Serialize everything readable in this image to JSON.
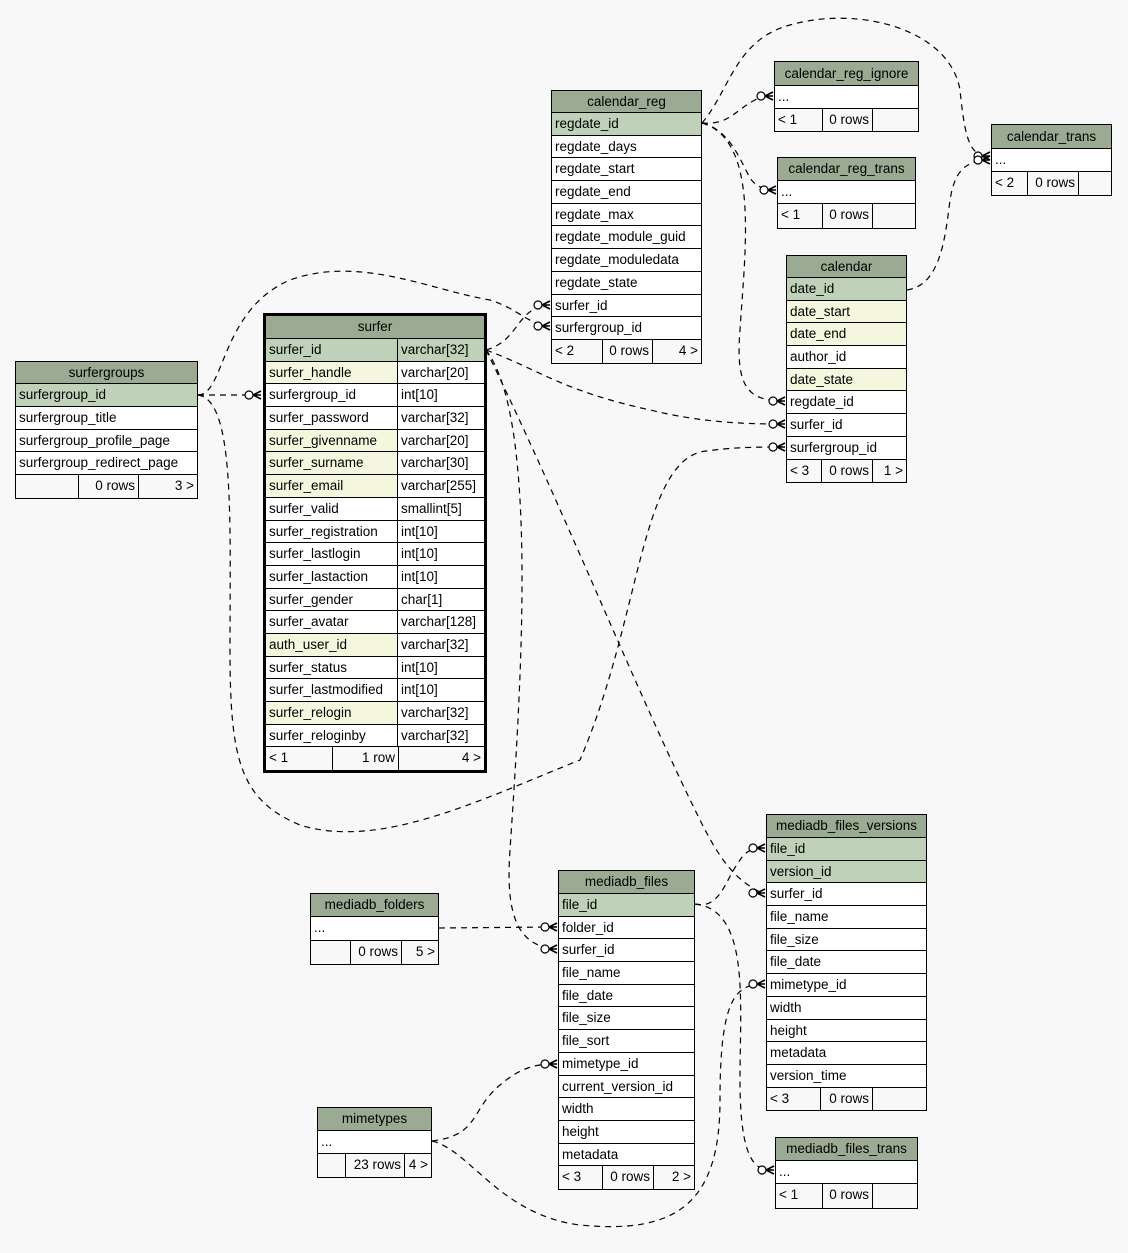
{
  "colors": {
    "background": "#f8f8f8",
    "header": "#9aaa93",
    "primary_key": "#bfd1b9",
    "indexed": "#f4f7de",
    "column": "#ffffff"
  },
  "tables": [
    {
      "name": "surfergroups",
      "columns": [
        {
          "name": "surfergroup_id",
          "kind": "pk"
        },
        {
          "name": "surfergroup_title",
          "kind": ""
        },
        {
          "name": "surfergroup_profile_page",
          "kind": ""
        },
        {
          "name": "surfergroup_redirect_page",
          "kind": ""
        }
      ],
      "footer": [
        "",
        "0 rows",
        "3 >"
      ]
    },
    {
      "name": "surfer",
      "focus": true,
      "columns": [
        {
          "name": "surfer_id",
          "type": "varchar[32]",
          "kind": "pk"
        },
        {
          "name": "surfer_handle",
          "type": "varchar[20]",
          "kind": "idx"
        },
        {
          "name": "surfergroup_id",
          "type": "int[10]",
          "kind": ""
        },
        {
          "name": "surfer_password",
          "type": "varchar[32]",
          "kind": ""
        },
        {
          "name": "surfer_givenname",
          "type": "varchar[20]",
          "kind": "idx"
        },
        {
          "name": "surfer_surname",
          "type": "varchar[30]",
          "kind": "idx"
        },
        {
          "name": "surfer_email",
          "type": "varchar[255]",
          "kind": "idx"
        },
        {
          "name": "surfer_valid",
          "type": "smallint[5]",
          "kind": ""
        },
        {
          "name": "surfer_registration",
          "type": "int[10]",
          "kind": ""
        },
        {
          "name": "surfer_lastlogin",
          "type": "int[10]",
          "kind": ""
        },
        {
          "name": "surfer_lastaction",
          "type": "int[10]",
          "kind": ""
        },
        {
          "name": "surfer_gender",
          "type": "char[1]",
          "kind": ""
        },
        {
          "name": "surfer_avatar",
          "type": "varchar[128]",
          "kind": ""
        },
        {
          "name": "auth_user_id",
          "type": "varchar[32]",
          "kind": "idx"
        },
        {
          "name": "surfer_status",
          "type": "int[10]",
          "kind": ""
        },
        {
          "name": "surfer_lastmodified",
          "type": "int[10]",
          "kind": ""
        },
        {
          "name": "surfer_relogin",
          "type": "varchar[32]",
          "kind": "idx"
        },
        {
          "name": "surfer_reloginby",
          "type": "varchar[32]",
          "kind": ""
        }
      ],
      "footer": [
        "< 1",
        "1 row",
        "4 >"
      ]
    },
    {
      "name": "calendar_reg",
      "columns": [
        {
          "name": "regdate_id",
          "kind": "pk"
        },
        {
          "name": "regdate_days",
          "kind": ""
        },
        {
          "name": "regdate_start",
          "kind": ""
        },
        {
          "name": "regdate_end",
          "kind": ""
        },
        {
          "name": "regdate_max",
          "kind": ""
        },
        {
          "name": "regdate_module_guid",
          "kind": ""
        },
        {
          "name": "regdate_moduledata",
          "kind": ""
        },
        {
          "name": "regdate_state",
          "kind": ""
        },
        {
          "name": "surfer_id",
          "kind": ""
        },
        {
          "name": "surfergroup_id",
          "kind": ""
        }
      ],
      "footer": [
        "< 2",
        "0 rows",
        "4 >"
      ]
    },
    {
      "name": "calendar_reg_ignore",
      "columns": [
        {
          "name": "...",
          "kind": ""
        }
      ],
      "footer": [
        "< 1",
        "0 rows",
        ""
      ]
    },
    {
      "name": "calendar_reg_trans",
      "columns": [
        {
          "name": "...",
          "kind": ""
        }
      ],
      "footer": [
        "< 1",
        "0 rows",
        ""
      ]
    },
    {
      "name": "calendar_trans",
      "columns": [
        {
          "name": "...",
          "kind": ""
        }
      ],
      "footer": [
        "< 2",
        "0 rows",
        ""
      ]
    },
    {
      "name": "calendar",
      "columns": [
        {
          "name": "date_id",
          "kind": "pk"
        },
        {
          "name": "date_start",
          "kind": "idx"
        },
        {
          "name": "date_end",
          "kind": "idx"
        },
        {
          "name": "author_id",
          "kind": ""
        },
        {
          "name": "date_state",
          "kind": "idx"
        },
        {
          "name": "regdate_id",
          "kind": ""
        },
        {
          "name": "surfer_id",
          "kind": ""
        },
        {
          "name": "surfergroup_id",
          "kind": ""
        }
      ],
      "footer": [
        "< 3",
        "0 rows",
        "1 >"
      ]
    },
    {
      "name": "mediadb_files_versions",
      "columns": [
        {
          "name": "file_id",
          "kind": "pk"
        },
        {
          "name": "version_id",
          "kind": "pk"
        },
        {
          "name": "surfer_id",
          "kind": ""
        },
        {
          "name": "file_name",
          "kind": ""
        },
        {
          "name": "file_size",
          "kind": ""
        },
        {
          "name": "file_date",
          "kind": ""
        },
        {
          "name": "mimetype_id",
          "kind": ""
        },
        {
          "name": "width",
          "kind": ""
        },
        {
          "name": "height",
          "kind": ""
        },
        {
          "name": "metadata",
          "kind": ""
        },
        {
          "name": "version_time",
          "kind": ""
        }
      ],
      "footer": [
        "< 3",
        "0 rows",
        ""
      ]
    },
    {
      "name": "mediadb_files",
      "columns": [
        {
          "name": "file_id",
          "kind": "pk"
        },
        {
          "name": "folder_id",
          "kind": ""
        },
        {
          "name": "surfer_id",
          "kind": ""
        },
        {
          "name": "file_name",
          "kind": ""
        },
        {
          "name": "file_date",
          "kind": ""
        },
        {
          "name": "file_size",
          "kind": ""
        },
        {
          "name": "file_sort",
          "kind": ""
        },
        {
          "name": "mimetype_id",
          "kind": ""
        },
        {
          "name": "current_version_id",
          "kind": ""
        },
        {
          "name": "width",
          "kind": ""
        },
        {
          "name": "height",
          "kind": ""
        },
        {
          "name": "metadata",
          "kind": ""
        }
      ],
      "footer": [
        "< 3",
        "0 rows",
        "2 >"
      ]
    },
    {
      "name": "mediadb_folders",
      "columns": [
        {
          "name": "...",
          "kind": ""
        }
      ],
      "footer": [
        "",
        "0 rows",
        "5 >"
      ]
    },
    {
      "name": "mimetypes",
      "columns": [
        {
          "name": "...",
          "kind": ""
        }
      ],
      "footer": [
        "",
        "23 rows",
        "4 >"
      ]
    },
    {
      "name": "mediadb_files_trans",
      "columns": [
        {
          "name": "...",
          "kind": ""
        }
      ],
      "footer": [
        "< 1",
        "0 rows",
        ""
      ]
    }
  ],
  "relationships": [
    {
      "from": "surfergroups.surfergroup_id",
      "to": "surfer.surfergroup_id"
    },
    {
      "from": "surfergroups.surfergroup_id",
      "to": "calendar_reg.surfergroup_id"
    },
    {
      "from": "surfergroups.surfergroup_id",
      "to": "calendar.surfergroup_id"
    },
    {
      "from": "surfer.surfer_id",
      "to": "calendar_reg.surfer_id"
    },
    {
      "from": "surfer.surfer_id",
      "to": "calendar.surfer_id"
    },
    {
      "from": "surfer.surfer_id",
      "to": "mediadb_files_versions.surfer_id"
    },
    {
      "from": "surfer.surfer_id",
      "to": "mediadb_files.surfer_id"
    },
    {
      "from": "calendar_reg.regdate_id",
      "to": "calendar_reg_ignore"
    },
    {
      "from": "calendar_reg.regdate_id",
      "to": "calendar_reg_trans"
    },
    {
      "from": "calendar_reg.regdate_id",
      "to": "calendar.regdate_id"
    },
    {
      "from": "calendar_reg.regdate_id",
      "to": "calendar_trans"
    },
    {
      "from": "calendar.date_id",
      "to": "calendar_trans"
    },
    {
      "from": "mediadb_folders",
      "to": "mediadb_files.folder_id"
    },
    {
      "from": "mimetypes",
      "to": "mediadb_files.mimetype_id"
    },
    {
      "from": "mimetypes",
      "to": "mediadb_files_versions.mimetype_id"
    },
    {
      "from": "mediadb_files.file_id",
      "to": "mediadb_files_versions.file_id"
    },
    {
      "from": "mediadb_files.file_id",
      "to": "mediadb_files_trans"
    }
  ]
}
